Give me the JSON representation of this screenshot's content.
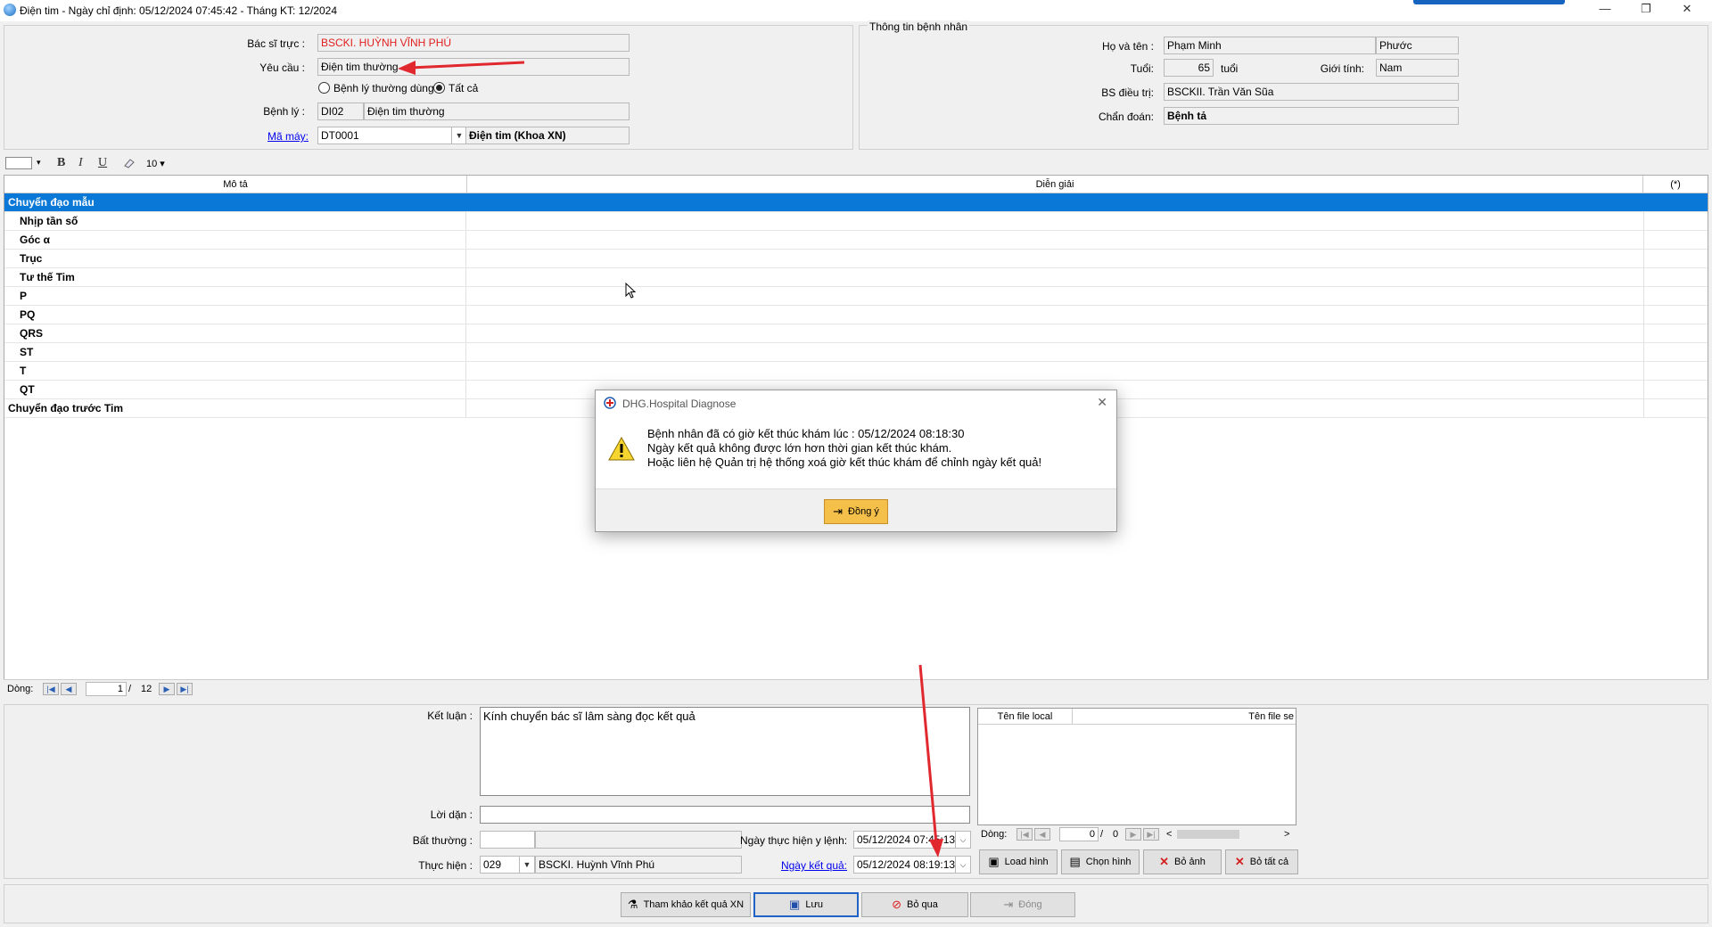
{
  "window": {
    "title": "Điện tim - Ngày chỉ định: 05/12/2024 07:45:42 - Tháng KT: 12/2024",
    "min_glyph": "—",
    "restore_glyph": "❐",
    "close_glyph": "✕"
  },
  "request": {
    "doctor_label": "Bác sĩ trực :",
    "doctor_value": "BSCKI. HUỲNH VĨNH PHÚ",
    "request_label": "Yêu cầu :",
    "request_value": "Điện tim thường",
    "radio_common": "Bệnh lý thường dùng",
    "radio_all": "Tất cả",
    "disease_label": "Bệnh lý :",
    "disease_code": "DI02",
    "disease_name": "Điện tim thường",
    "machine_label": "Mã máy:",
    "machine_code": "DT0001",
    "machine_name": "Điện tim (Khoa XN)"
  },
  "patient": {
    "group_title": "Thông tin bệnh nhân",
    "name_label": "Họ và tên :",
    "last_name": "Phạm Minh",
    "first_name": "Phước",
    "age_label": "Tuổi:",
    "age_value": "65",
    "age_unit": "tuổi",
    "gender_label": "Giới tính:",
    "gender_value": "Nam",
    "treating_label": "BS điều trị:",
    "treating_value": "BSCKII. Trần Văn Sũa",
    "diagnosis_label": "Chẩn đoán:",
    "diagnosis_value": "Bệnh tả"
  },
  "toolbar": {
    "bold": "B",
    "italic": "I",
    "underline": "U",
    "font_size": "10 ▾"
  },
  "grid": {
    "col_desc": "Mô tả",
    "col_interp": "Diễn giải",
    "col_star": "(*)",
    "rows": [
      "Chuyển đạo mẫu",
      "Nhịp tần số",
      "Góc α",
      "Trục",
      "Tư thế Tim",
      "P",
      "PQ",
      "QRS",
      "ST",
      "T",
      "QT",
      "Chuyển đạo trước Tim"
    ],
    "nav_label": "Dòng:",
    "nav_current": "1",
    "nav_sep": "/",
    "nav_total": "12"
  },
  "result": {
    "conclusion_label": "Kết luận :",
    "conclusion_value": "Kính chuyển bác sĩ lâm sàng đọc kết quả",
    "advice_label": "Lời dặn :",
    "abnormal_label": "Bất thường :",
    "performer_label": "Thực hiện :",
    "performer_code": "029",
    "performer_name": "BSCKI. Huỳnh Vĩnh Phú",
    "order_date_label": "Ngày thực hiện y lệnh:",
    "order_date_value": "05/12/2024 07:45:13",
    "result_date_label": "Ngày kết quả:",
    "result_date_value": "05/12/2024 08:19:13"
  },
  "files": {
    "col_local": "Tên file local",
    "col_server": "Tên file se",
    "nav_label": "Dòng:",
    "nav_current": "0",
    "nav_sep": "/",
    "nav_total": "0",
    "load_button": "Load hình",
    "choose_button": "Chọn hình",
    "remove_button": "Bỏ ảnh",
    "remove_all_button": "Bỏ tất cả"
  },
  "actions": {
    "reference_button": "Tham khảo kết quả XN",
    "save_button": "Lưu",
    "skip_button": "Bỏ qua",
    "close_button": "Đóng"
  },
  "dialog": {
    "title": "DHG.Hospital Diagnose",
    "line1": "Bệnh nhân đã có giờ kết thúc khám lúc : 05/12/2024 08:18:30",
    "line2": "Ngày kết quả không được lớn hơn thời gian kết thúc khám.",
    "line3": "Hoặc liên hệ Quản trị hệ thống xoá giờ kết thúc khám để chỉnh ngày kết quả!",
    "ok_button": "Đồng ý"
  },
  "colors": {
    "selection": "#0a78d7",
    "doctor_text": "#e02020",
    "annotation_arrow": "#e0282e",
    "ok_button": "#f5c04a"
  }
}
